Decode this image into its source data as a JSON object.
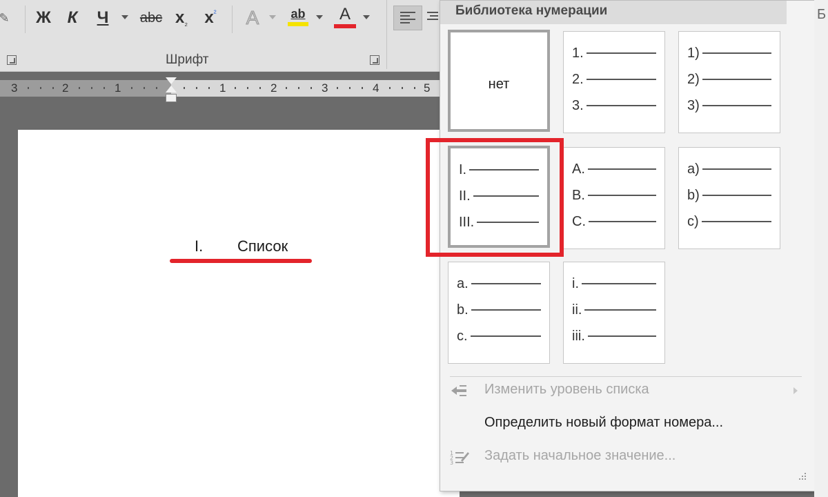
{
  "ribbon": {
    "bold_label": "Ж",
    "italic_label": "К",
    "underline_label": "Ч",
    "strike_label": "abc",
    "subscript_base": "x",
    "subscript_mark": "₂",
    "superscript_base": "x",
    "superscript_mark": "²",
    "text_effects_label": "A",
    "highlight_label": "ab",
    "font_color_label": "A",
    "font_group_label": "Шрифт",
    "highlight_color": "#f5e300",
    "font_color": "#e3242b"
  },
  "ruler": {
    "left_numbers": [
      "3",
      "2",
      "1"
    ],
    "right_numbers": [
      "1",
      "2",
      "3",
      "4",
      "5"
    ]
  },
  "document": {
    "list_number": "I.",
    "list_text": "Список",
    "underline_color": "#e3242b"
  },
  "numbering_library": {
    "title": "Библиотека нумерации",
    "none_label": "нет",
    "tiles": [
      {
        "id": "arabic-dot",
        "labels": [
          "1.",
          "2.",
          "3."
        ]
      },
      {
        "id": "arabic-paren",
        "labels": [
          "1)",
          "2)",
          "3)"
        ]
      },
      {
        "id": "roman-upper",
        "labels": [
          "I.",
          "II.",
          "III."
        ]
      },
      {
        "id": "alpha-upper",
        "labels": [
          "A.",
          "B.",
          "C."
        ]
      },
      {
        "id": "alpha-lower-paren",
        "labels": [
          "a)",
          "b)",
          "c)"
        ]
      },
      {
        "id": "alpha-lower-dot",
        "labels": [
          "a.",
          "b.",
          "c."
        ]
      },
      {
        "id": "roman-lower",
        "labels": [
          "i.",
          "ii.",
          "iii."
        ]
      }
    ],
    "highlight_color": "#e3242b"
  },
  "menu": {
    "change_level": "Изменить уровень списка",
    "define_format": "Определить новый формат номера...",
    "set_start": "Задать начальное значение..."
  },
  "right_edge_glyph": "Б"
}
